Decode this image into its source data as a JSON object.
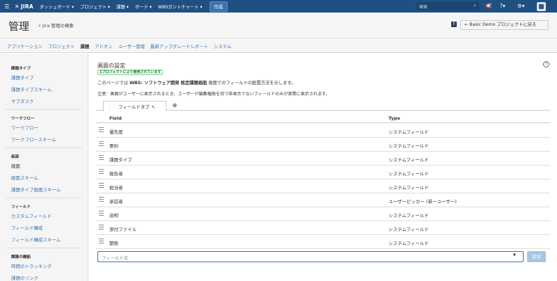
{
  "topnav": {
    "logo": "JIRA",
    "items": [
      "ダッシュボード ▾",
      "プロジェクト ▾",
      "課題 ▾",
      "ボード ▾",
      "WBSガントチャート ▾"
    ],
    "create": "作成",
    "search_placeholder": "検索"
  },
  "header": {
    "title": "管理",
    "admin_search": "Jira 管理の検索",
    "back_button": "← Basic Demo プロジェクトに戻る"
  },
  "admin_tabs": [
    {
      "label": "アプリケーション"
    },
    {
      "label": "プロジェクト"
    },
    {
      "label": "課題"
    },
    {
      "label": "アドオン"
    },
    {
      "label": "ユーザー管理"
    },
    {
      "label": "最新アップグレードレポート"
    },
    {
      "label": "システム"
    }
  ],
  "sidebar": {
    "groups": [
      {
        "heading": "課題タイプ",
        "items": [
          "課題タイプ",
          "課題タイプスキーム",
          "サブタスク"
        ]
      },
      {
        "heading": "ワークフロー",
        "items": [
          "ワークフロー",
          "ワークフロースキーム"
        ]
      },
      {
        "heading": "画面",
        "items": [
          "画面",
          "画面スキーム",
          "課題タイプ画面スキーム"
        ]
      },
      {
        "heading": "フィールド",
        "items": [
          "カスタムフィールド",
          "フィールド構成",
          "フィールド構成スキーム"
        ]
      },
      {
        "heading": "課題の機能",
        "items": [
          "時間のトラッキング",
          "課題のリンク"
        ]
      }
    ]
  },
  "main": {
    "title": "画面の設定",
    "badge": "1プロジェクトにより使用されています",
    "desc_prefix": "このページでは",
    "desc_screen": "WBS: ソフトウェア開発 既定課題画面",
    "desc_suffix": "画面でのフィールドの配置方法を示します。",
    "note": "注意：画面がユーザーに表示されるとき、ユーザーが編集権限を持つ非表示でないフィールドのみが実際に表示されます。",
    "tab_label": "フィールドタブ",
    "col_field": "Field",
    "col_type": "Type",
    "rows": [
      {
        "field": "優先度",
        "type": "システムフィールド"
      },
      {
        "field": "要約",
        "type": "システムフィールド"
      },
      {
        "field": "課題タイプ",
        "type": "システムフィールド"
      },
      {
        "field": "報告者",
        "type": "システムフィールド"
      },
      {
        "field": "担当者",
        "type": "システムフィールド"
      },
      {
        "field": "承認者",
        "type": "ユーザーピッカー (単一ユーザー)"
      },
      {
        "field": "説明",
        "type": "システムフィールド"
      },
      {
        "field": "添付ファイル",
        "type": "システムフィールド"
      },
      {
        "field": "期限",
        "type": "システムフィールド"
      }
    ],
    "field_input_placeholder": "フィールド名",
    "add_button": "追加"
  }
}
